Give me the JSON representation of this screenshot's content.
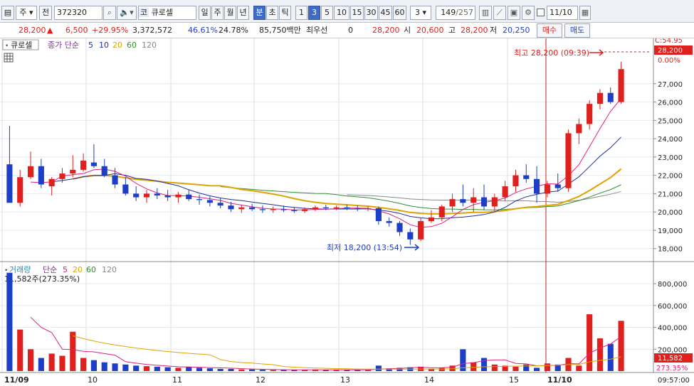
{
  "toolbar": {
    "market_type": "주",
    "prev_label": "전",
    "code": "372320",
    "market_prefix": "코",
    "stock_name": "큐로셀",
    "periods": [
      "일",
      "주",
      "월",
      "년"
    ],
    "active_period": "분",
    "extra_periods": [
      "초",
      "틱"
    ],
    "minute_options": [
      "1",
      "3",
      "5",
      "10",
      "15",
      "30",
      "45",
      "60"
    ],
    "active_minute": "3",
    "minute_select": "3",
    "page_counter": "149",
    "page_total": "/257",
    "date_value": "11/10",
    "icons": [
      "search-icon",
      "speaker-icon",
      "candle-icon",
      "line-draw-icon",
      "save-icon",
      "gear-icon"
    ]
  },
  "quote": {
    "price": "28,200",
    "change": "6,500",
    "change_pct": "+29.95%",
    "volume": "3,372,572",
    "vol_ratio": "46.61%",
    "turnover": "24.78%",
    "amount": "85,750백만",
    "pref_label": "최우선",
    "pref_value": "0",
    "pref_price": "28,200",
    "open_label": "시",
    "open": "20,600",
    "high_label": "고",
    "high": "28,200",
    "low_label": "저",
    "low": "20,250",
    "buy_label": "매수",
    "sell_label": "매도"
  },
  "price_panel": {
    "stock_tag": "큐로셀",
    "ma_label": "종가 단순",
    "ma_periods": [
      "5",
      "10",
      "20",
      "60",
      "120"
    ],
    "ma_colors": [
      "#1d2f9c",
      "#1d2f9c",
      "#e0a300",
      "#2f8f2f",
      "#888888"
    ],
    "high_note": "최고 28,200 (09:39)",
    "low_note": "최저 18,200 (13:54)",
    "right_label_c": "C:54.95",
    "right_price": "28,200",
    "right_pct": "0.00%",
    "y_ticks": [
      "27,000",
      "26,000",
      "25,000",
      "24,000",
      "23,000",
      "22,000",
      "21,000",
      "20,000",
      "19,000",
      "18,000"
    ]
  },
  "volume_panel": {
    "title": "거래량",
    "ma_label": "단순",
    "ma_periods": [
      "5",
      "20",
      "60",
      "120"
    ],
    "current": "11,582주(273.35%)",
    "y_ticks": [
      "800,000",
      "600,000",
      "400,000",
      "200,000"
    ],
    "right_value": "11,582",
    "right_pct": "273.35%"
  },
  "x_axis": {
    "labels": [
      "11/09",
      "10",
      "11",
      "12",
      "13",
      "14",
      "15",
      "11/10"
    ],
    "time": "09:57:00"
  },
  "colors": {
    "up": "#e0201c",
    "down": "#1d3fc7",
    "ma5": "#e0207c",
    "ma10": "#1d2f9c",
    "ma20": "#e0a300",
    "ma60": "#2f8f2f",
    "ma120": "#888888"
  },
  "chart_data": {
    "type": "candlestick",
    "title": "큐로셀",
    "ylim": [
      17600,
      28700
    ],
    "price_series": [
      {
        "o": 22600,
        "h": 24700,
        "l": 20900,
        "c": 20500
      },
      {
        "o": 20500,
        "h": 22300,
        "l": 20300,
        "c": 21900
      },
      {
        "o": 21900,
        "h": 23300,
        "l": 21800,
        "c": 22500
      },
      {
        "o": 22500,
        "h": 22900,
        "l": 21300,
        "c": 21500
      },
      {
        "o": 21400,
        "h": 21900,
        "l": 20900,
        "c": 21800
      },
      {
        "o": 21800,
        "h": 22400,
        "l": 21600,
        "c": 22100
      },
      {
        "o": 22100,
        "h": 23100,
        "l": 21900,
        "c": 22300
      },
      {
        "o": 22300,
        "h": 23200,
        "l": 22200,
        "c": 22800
      },
      {
        "o": 22700,
        "h": 23700,
        "l": 22400,
        "c": 22500
      },
      {
        "o": 22500,
        "h": 22900,
        "l": 21900,
        "c": 22000
      },
      {
        "o": 22000,
        "h": 22400,
        "l": 21300,
        "c": 21500
      },
      {
        "o": 21500,
        "h": 21900,
        "l": 20900,
        "c": 21000
      },
      {
        "o": 21000,
        "h": 21400,
        "l": 20600,
        "c": 20800
      },
      {
        "o": 20800,
        "h": 21200,
        "l": 20500,
        "c": 21000
      },
      {
        "o": 21000,
        "h": 21300,
        "l": 20700,
        "c": 20900
      },
      {
        "o": 20900,
        "h": 21200,
        "l": 20600,
        "c": 20800
      },
      {
        "o": 20800,
        "h": 21100,
        "l": 20500,
        "c": 20950
      },
      {
        "o": 20950,
        "h": 21200,
        "l": 20600,
        "c": 20700
      },
      {
        "o": 20700,
        "h": 20950,
        "l": 20400,
        "c": 20650
      },
      {
        "o": 20650,
        "h": 20850,
        "l": 20300,
        "c": 20500
      },
      {
        "o": 20500,
        "h": 20750,
        "l": 20200,
        "c": 20350
      },
      {
        "o": 20350,
        "h": 20550,
        "l": 20000,
        "c": 20150
      },
      {
        "o": 20150,
        "h": 20400,
        "l": 19950,
        "c": 20250
      },
      {
        "o": 20250,
        "h": 20450,
        "l": 20050,
        "c": 20150
      },
      {
        "o": 20150,
        "h": 20350,
        "l": 19950,
        "c": 20100
      },
      {
        "o": 20100,
        "h": 20300,
        "l": 19950,
        "c": 20150
      },
      {
        "o": 20150,
        "h": 20350,
        "l": 20000,
        "c": 20100
      },
      {
        "o": 20100,
        "h": 20250,
        "l": 19950,
        "c": 20050
      },
      {
        "o": 20050,
        "h": 20250,
        "l": 19950,
        "c": 20150
      },
      {
        "o": 20150,
        "h": 20350,
        "l": 20050,
        "c": 20250
      },
      {
        "o": 20250,
        "h": 20400,
        "l": 20100,
        "c": 20200
      },
      {
        "o": 20200,
        "h": 20350,
        "l": 20100,
        "c": 20250
      },
      {
        "o": 20250,
        "h": 20400,
        "l": 20100,
        "c": 20200
      },
      {
        "o": 20200,
        "h": 20350,
        "l": 20050,
        "c": 20150
      },
      {
        "o": 20150,
        "h": 20300,
        "l": 20050,
        "c": 20200
      },
      {
        "o": 20200,
        "h": 20300,
        "l": 19300,
        "c": 19500
      },
      {
        "o": 19500,
        "h": 19700,
        "l": 19200,
        "c": 19400
      },
      {
        "o": 19400,
        "h": 19500,
        "l": 18700,
        "c": 18900
      },
      {
        "o": 18900,
        "h": 19100,
        "l": 18200,
        "c": 18500
      },
      {
        "o": 18500,
        "h": 19700,
        "l": 18400,
        "c": 19500
      },
      {
        "o": 19500,
        "h": 20100,
        "l": 19400,
        "c": 19700
      },
      {
        "o": 19700,
        "h": 20400,
        "l": 19500,
        "c": 20300
      },
      {
        "o": 20300,
        "h": 21000,
        "l": 20000,
        "c": 20700
      },
      {
        "o": 20700,
        "h": 21500,
        "l": 20300,
        "c": 20500
      },
      {
        "o": 20500,
        "h": 21300,
        "l": 20000,
        "c": 20800
      },
      {
        "o": 20800,
        "h": 21500,
        "l": 20100,
        "c": 20300
      },
      {
        "o": 20300,
        "h": 21000,
        "l": 20000,
        "c": 20800
      },
      {
        "o": 20800,
        "h": 21700,
        "l": 20600,
        "c": 21400
      },
      {
        "o": 21400,
        "h": 22300,
        "l": 21100,
        "c": 22000
      },
      {
        "o": 22000,
        "h": 22600,
        "l": 21600,
        "c": 21800
      },
      {
        "o": 21800,
        "h": 22500,
        "l": 20500,
        "c": 21000
      },
      {
        "o": 21000,
        "h": 21700,
        "l": 20800,
        "c": 21500
      },
      {
        "o": 21500,
        "h": 22100,
        "l": 21100,
        "c": 21300
      },
      {
        "o": 21300,
        "h": 24500,
        "l": 21100,
        "c": 24300
      },
      {
        "o": 24300,
        "h": 25100,
        "l": 23700,
        "c": 24800
      },
      {
        "o": 24800,
        "h": 26100,
        "l": 24500,
        "c": 25900
      },
      {
        "o": 25900,
        "h": 26700,
        "l": 25600,
        "c": 26500
      },
      {
        "o": 26500,
        "h": 26800,
        "l": 25900,
        "c": 26000
      },
      {
        "o": 26000,
        "h": 28200,
        "l": 25900,
        "c": 27800
      }
    ],
    "volume_series": [
      900000,
      380000,
      200000,
      120000,
      160000,
      140000,
      360000,
      120000,
      100000,
      80000,
      70000,
      60000,
      50000,
      45000,
      40000,
      35000,
      30000,
      40000,
      30000,
      25000,
      20000,
      20000,
      15000,
      15000,
      12000,
      10000,
      10000,
      12000,
      10000,
      15000,
      12000,
      10000,
      12000,
      10000,
      10000,
      50000,
      25000,
      30000,
      35000,
      40000,
      20000,
      30000,
      50000,
      200000,
      80000,
      120000,
      60000,
      50000,
      40000,
      60000,
      30000,
      70000,
      60000,
      120000,
      50000,
      520000,
      300000,
      250000,
      460000,
      70000,
      11582
    ],
    "volume_ylim": [
      0,
      950000
    ]
  }
}
